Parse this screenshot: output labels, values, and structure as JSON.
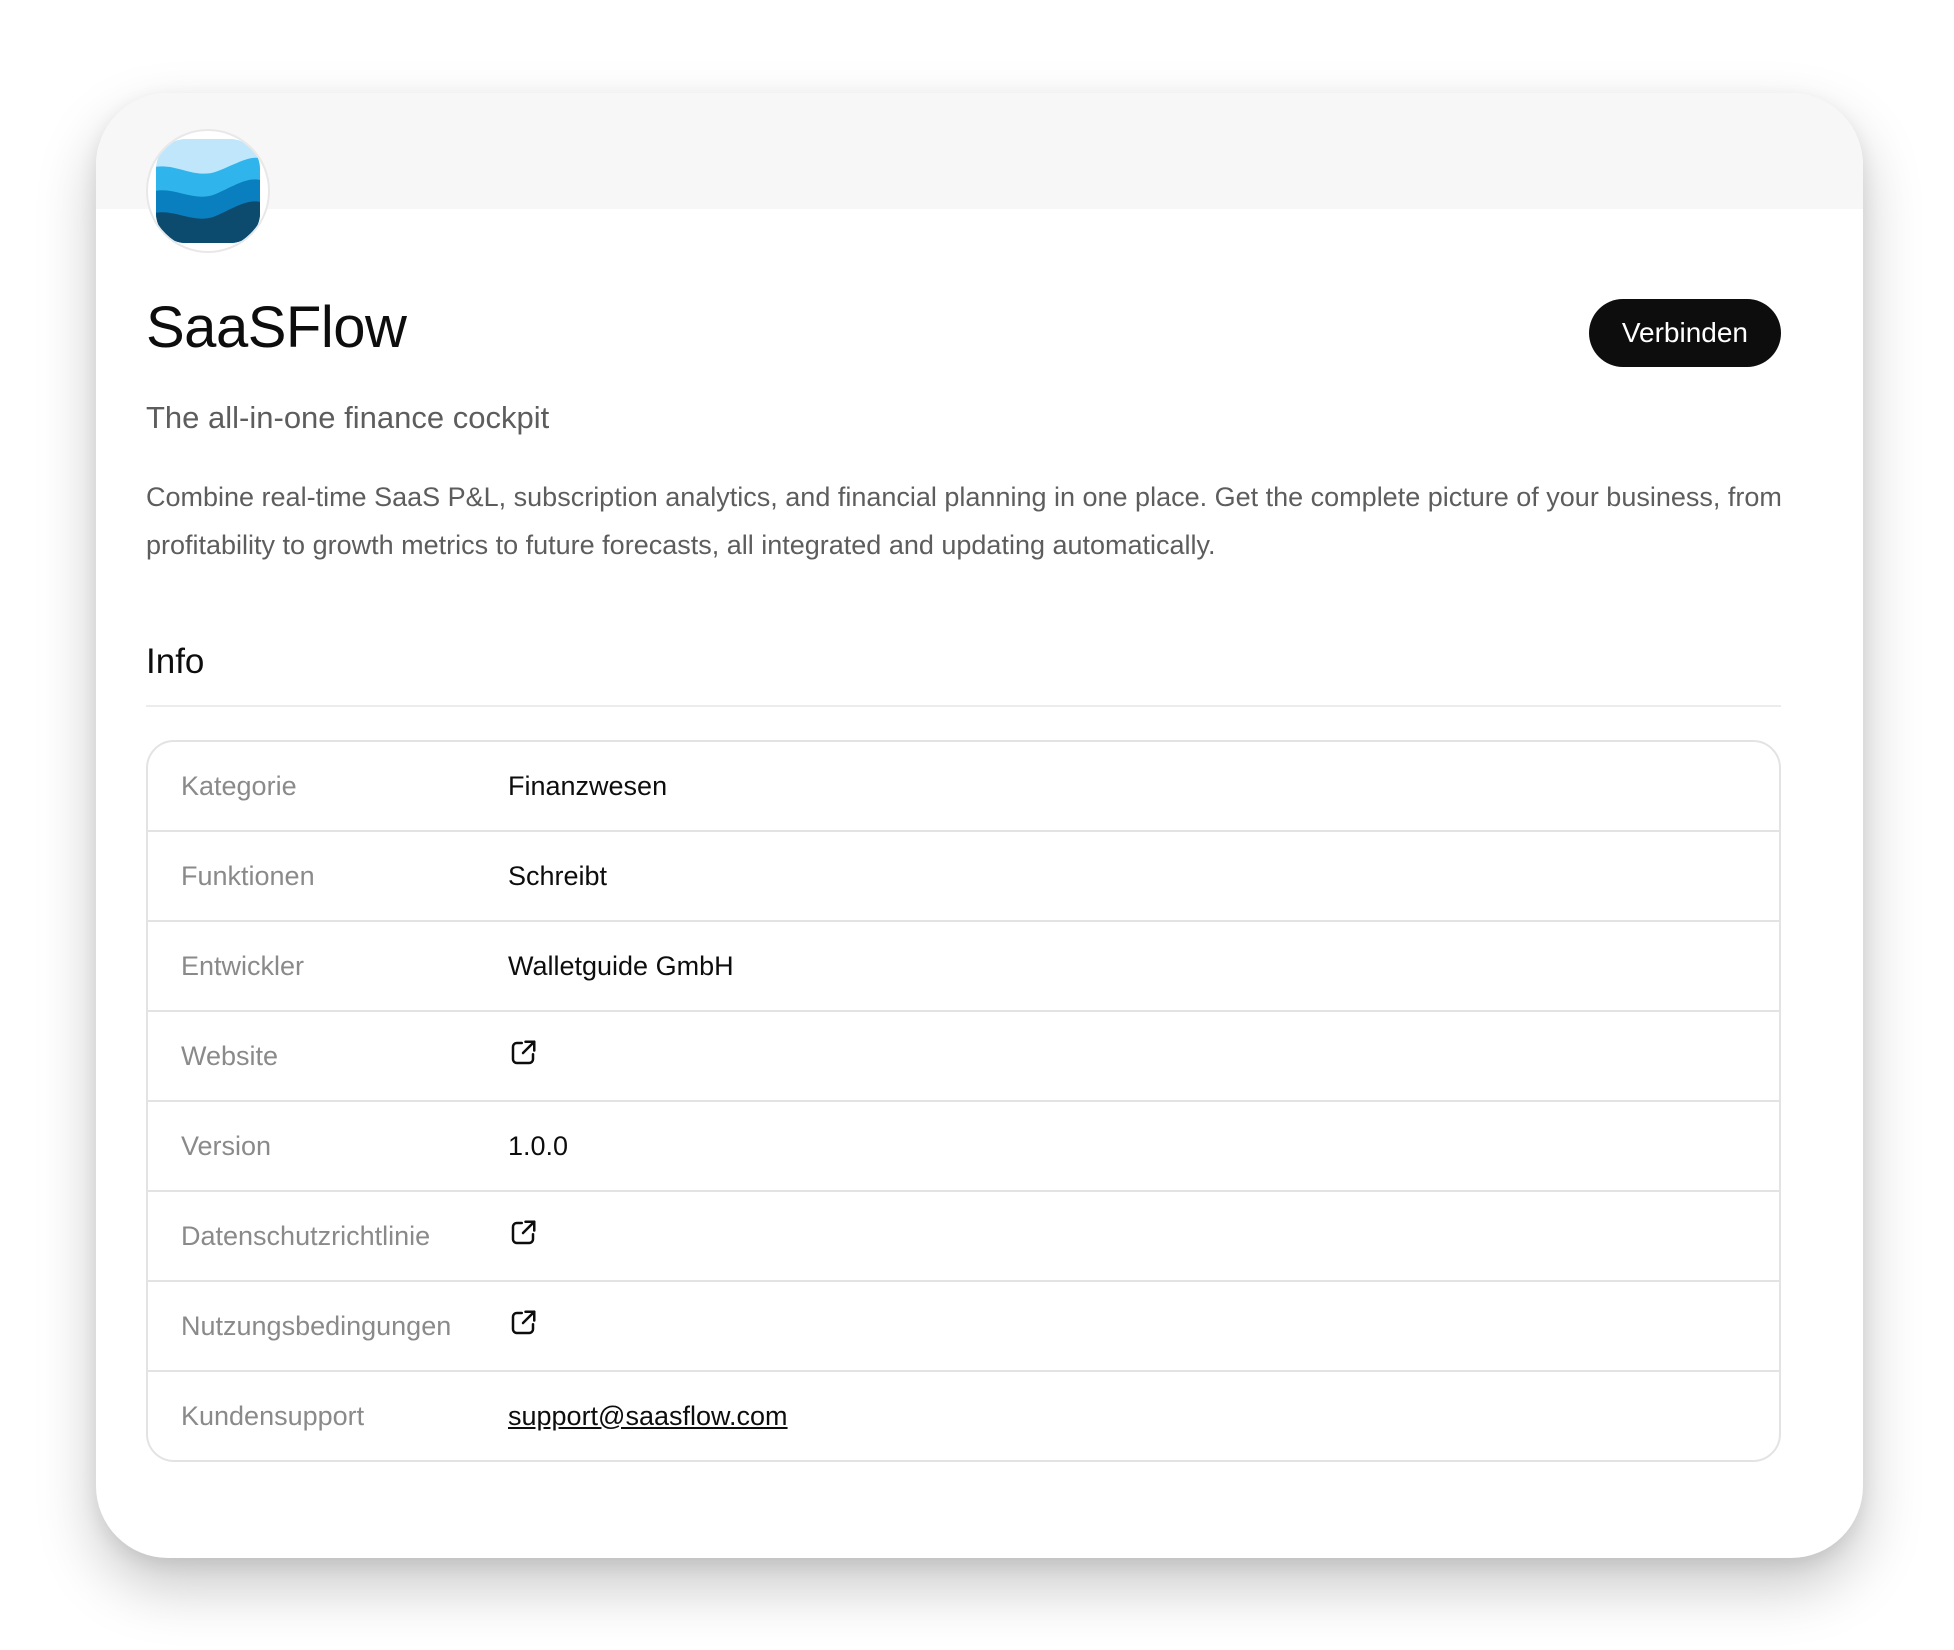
{
  "app": {
    "name": "SaaSFlow",
    "tagline": "The all-in-one finance cockpit",
    "description": "Combine real-time SaaS P&L, subscription analytics, and financial planning in one place. Get the complete picture of your business, from profitability to growth metrics to future forecasts, all integrated and updating automatically.",
    "connect_label": "Verbinden",
    "icon": "wave-logo-icon"
  },
  "info": {
    "title": "Info",
    "rows": [
      {
        "label": "Kategorie",
        "value": "Finanzwesen"
      },
      {
        "label": "Funktionen",
        "value": "Schreibt"
      },
      {
        "label": "Entwickler",
        "value": "Walletguide GmbH"
      },
      {
        "label": "Website",
        "icon": "external-link-icon"
      },
      {
        "label": "Version",
        "value": "1.0.0"
      },
      {
        "label": "Datenschutzrichtlinie",
        "icon": "external-link-icon"
      },
      {
        "label": "Nutzungsbedingungen",
        "icon": "external-link-icon"
      },
      {
        "label": "Kundensupport",
        "value": "support@saasflow.com"
      }
    ]
  },
  "colors": {
    "button_bg": "#0d0d0d",
    "button_text": "#ffffff",
    "label_gray": "#8a8a8a",
    "text_gray": "#5d5d5d",
    "wave_light": "#bfe6fb",
    "wave_mid": "#2fb5ec",
    "wave_blue": "#0a7fc0",
    "wave_dark": "#0c4a6e"
  }
}
